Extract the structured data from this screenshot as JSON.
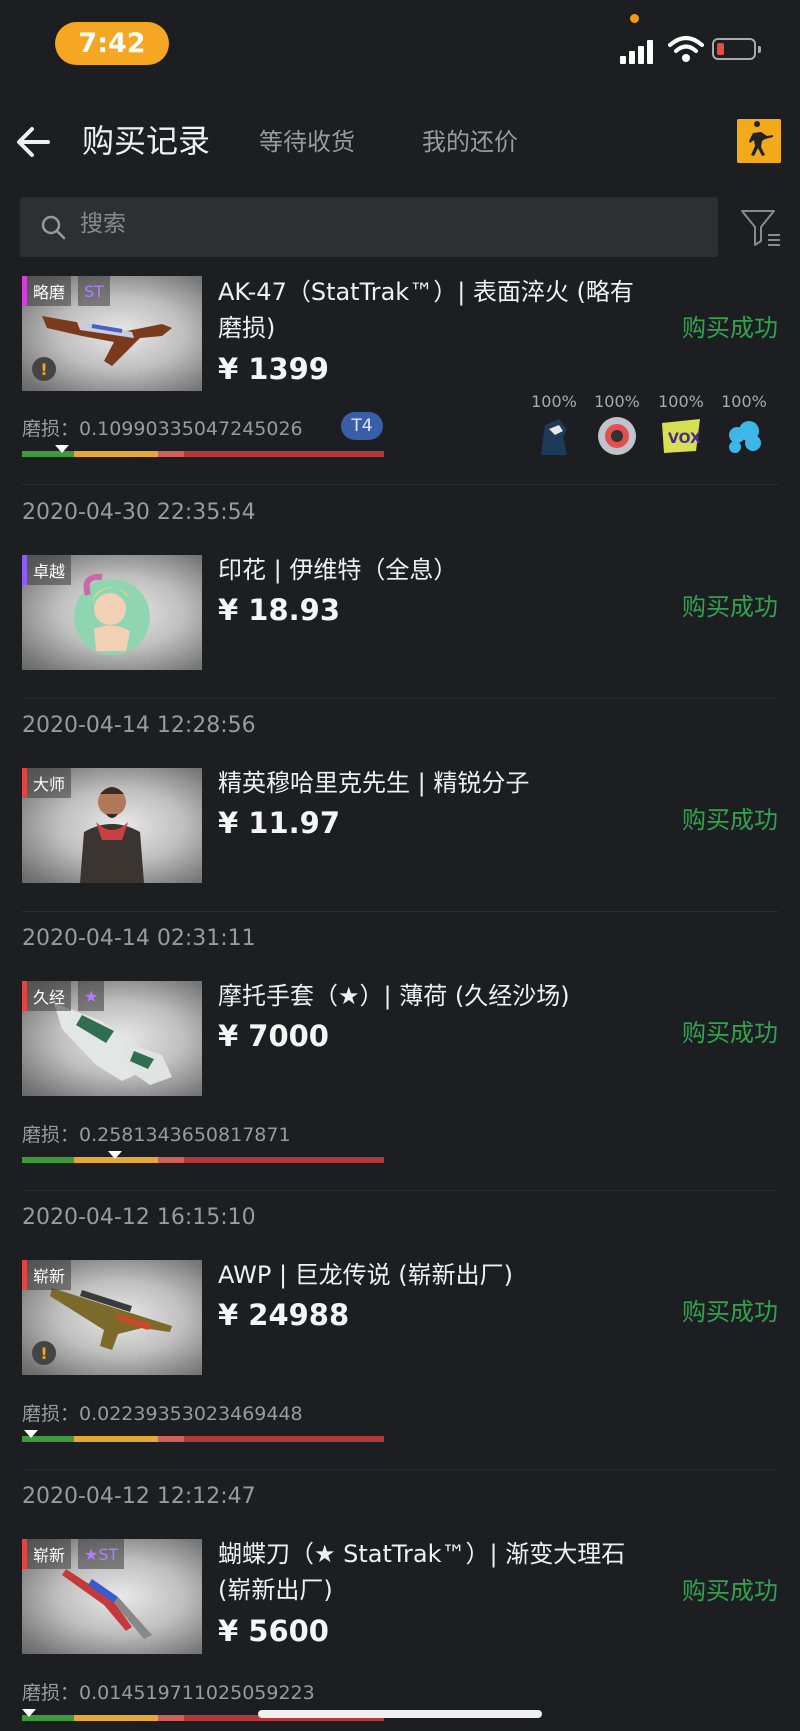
{
  "status_bar": {
    "time": "7:42"
  },
  "nav": {
    "active_tab": "购买记录",
    "tab2": "等待收货",
    "tab3": "我的还价"
  },
  "search": {
    "placeholder": "搜索"
  },
  "items": [
    {
      "quality_tag": "略磨",
      "quality_color": "#d13fd8",
      "extra_tag": "ST",
      "extra_color": "#b57bff",
      "name": "AK-47（StatTrak™）| 表面淬火 (略有磨损)",
      "price": "¥ 1399",
      "status": "购买成功",
      "wear_label": "磨损：0.10990335047245026",
      "badge": "T4",
      "has_warning": true,
      "stickers": [
        {
          "pct": "100%",
          "icon": "team-liquid-horse-icon"
        },
        {
          "pct": "100%",
          "icon": "round-sticker-icon"
        },
        {
          "pct": "100%",
          "icon": "vox-sticker-icon"
        },
        {
          "pct": "100%",
          "icon": "cloud9-sticker-icon"
        }
      ]
    },
    {
      "date": "2020-04-30 22:35:54",
      "quality_tag": "卓越",
      "quality_color": "#8e5cf7",
      "name": "印花 | 伊维特（全息）",
      "price": "¥ 18.93",
      "status": "购买成功"
    },
    {
      "date": "2020-04-14 12:28:56",
      "quality_tag": "大师",
      "quality_color": "#e04545",
      "name": "精英穆哈里克先生 | 精锐分子",
      "price": "¥ 11.97",
      "status": "购买成功"
    },
    {
      "date": "2020-04-14 02:31:11",
      "quality_tag": "久经",
      "quality_color": "#e04545",
      "extra_tag": "★",
      "extra_color": "#b57bff",
      "name": "摩托手套（★）| 薄荷 (久经沙场)",
      "price": "¥ 7000",
      "status": "购买成功",
      "wear_label": "磨损：0.2581343650817871"
    },
    {
      "date": "2020-04-12 16:15:10",
      "quality_tag": "崭新",
      "quality_color": "#e04545",
      "name": "AWP | 巨龙传说 (崭新出厂)",
      "price": "¥ 24988",
      "status": "购买成功",
      "wear_label": "磨损：0.02239353023469448",
      "has_warning": true
    },
    {
      "date": "2020-04-12 12:12:47",
      "quality_tag": "崭新",
      "quality_color": "#e04545",
      "extra_tag": "★ST",
      "extra_color": "#b57bff",
      "name": "蝴蝶刀（★ StatTrak™）| 渐变大理石 (崭新出厂)",
      "price": "¥ 5600",
      "status": "购买成功",
      "wear_label": "磨损：0.014519711025059223"
    }
  ],
  "colors": {
    "accent": "#f5a623",
    "success": "#2ea44f",
    "background": "#1d1e21"
  }
}
